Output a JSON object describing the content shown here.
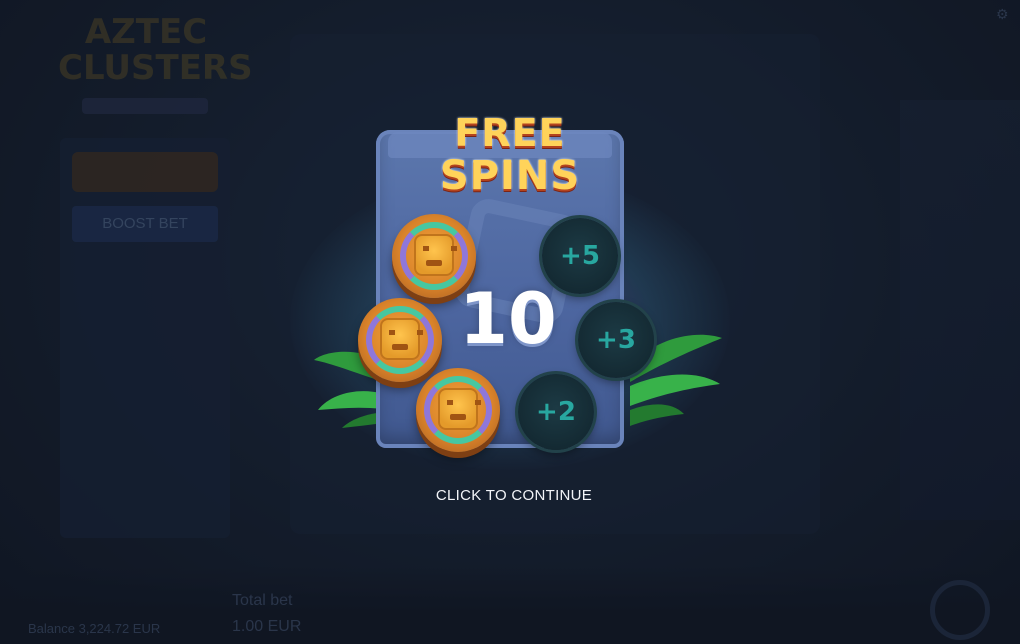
{
  "background": {
    "boost_label": "BOOST BET",
    "balance_label": "Balance 3,224.72 EUR",
    "total_bet_label": "Total bet",
    "total_bet_value": "1.00 EUR"
  },
  "popup": {
    "title_line1": "FREE",
    "title_line2": "SPINS",
    "spins_count": "10",
    "bonus_values": [
      "+5",
      "+3",
      "+2"
    ],
    "continue_label": "CLICK TO CONTINUE"
  },
  "colors": {
    "title_gold": "#ffd35a",
    "bonus_teal": "#28a7a0",
    "stone_blue": "#5c77ad",
    "coin_orange": "#d9832a"
  }
}
